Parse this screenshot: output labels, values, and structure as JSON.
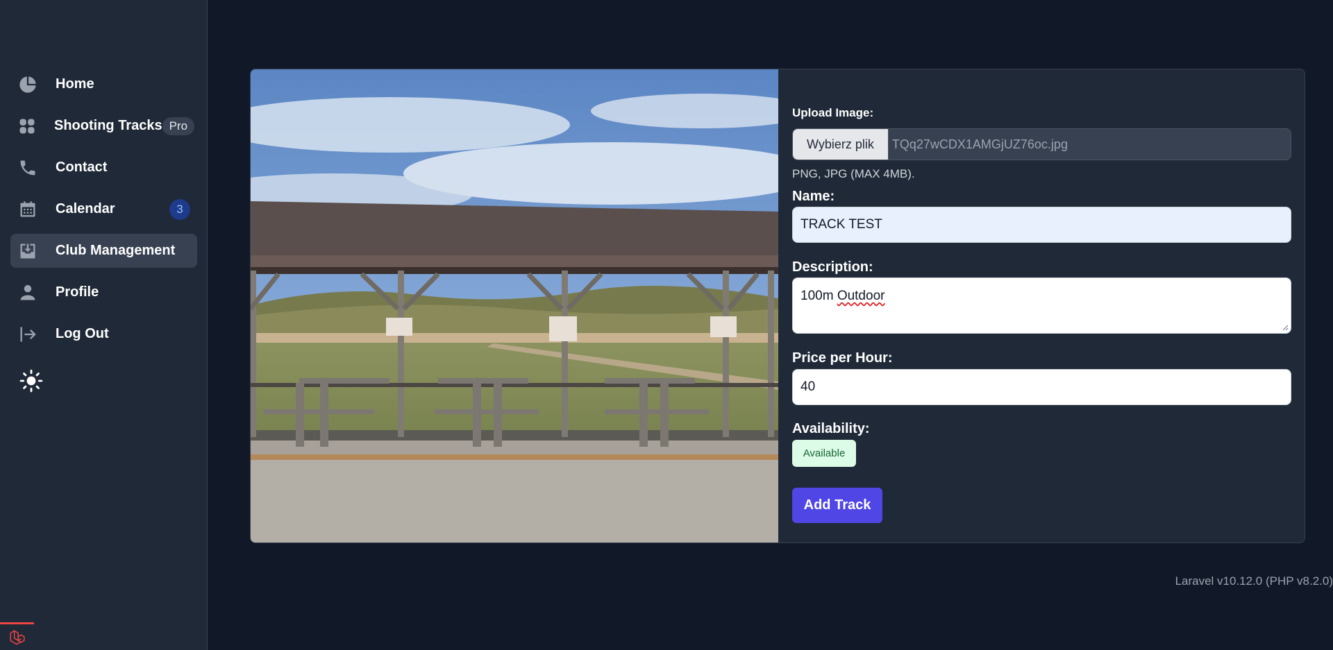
{
  "sidebar": {
    "items": [
      {
        "label": "Home",
        "icon": "pie-chart-icon"
      },
      {
        "label": "Shooting Tracks",
        "icon": "grid-icon",
        "badge": "Pro"
      },
      {
        "label": "Contact",
        "icon": "phone-icon"
      },
      {
        "label": "Calendar",
        "icon": "calendar-icon",
        "badge": "3"
      },
      {
        "label": "Club Management",
        "icon": "inbox-download-icon",
        "active": true
      },
      {
        "label": "Profile",
        "icon": "user-icon"
      },
      {
        "label": "Log Out",
        "icon": "logout-arrow-icon"
      }
    ],
    "theme_toggle_icon": "sun-icon"
  },
  "form": {
    "upload_label": "Upload Image:",
    "file_button": "Wybierz plik",
    "file_name": "TQq27wCDX1AMGjUZ76oc.jpg",
    "file_hint": "PNG, JPG (MAX 4MB).",
    "name_label": "Name:",
    "name_value": "TRACK TEST",
    "description_label": "Description:",
    "description_value_plain": "100m ",
    "description_value_flagged": "Outdoor",
    "price_label": "Price per Hour:",
    "price_value": "40",
    "availability_label": "Availability:",
    "availability_value": "Available",
    "submit_label": "Add Track"
  },
  "footer": {
    "version": "Laravel v10.12.0 (PHP v8.2.0)"
  },
  "colors": {
    "background": "#111827",
    "sidebar": "#1f2937",
    "accent": "#4f46e5",
    "available_bg": "#dcfce7",
    "available_text": "#166534",
    "laravel_red": "#ef4444"
  }
}
